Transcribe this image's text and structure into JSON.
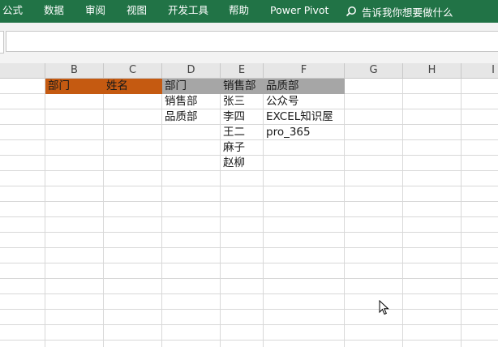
{
  "ribbon": {
    "tabs": [
      "公式",
      "数据",
      "审阅",
      "视图",
      "开发工具",
      "帮助",
      "Power Pivot"
    ],
    "tell_me": "告诉我你想要做什么"
  },
  "column_headers": [
    "B",
    "C",
    "D",
    "E",
    "F",
    "G",
    "H",
    "I"
  ],
  "cells": {
    "B1": "部门",
    "C1": "姓名",
    "D1": "部门",
    "D2": "销售部",
    "D3": "品质部",
    "E1": "销售部",
    "E2": "张三",
    "E3": "李四",
    "E4": "王二",
    "E5": "麻子",
    "E6": "赵柳",
    "F1": "品质部",
    "F2": "公众号",
    "F3": "EXCEL知识屋",
    "F4": "pro_365"
  },
  "colors": {
    "ribbon": "#217346",
    "header_fill_orange": "#c55a11",
    "header_fill_gray": "#a6a6a6"
  }
}
